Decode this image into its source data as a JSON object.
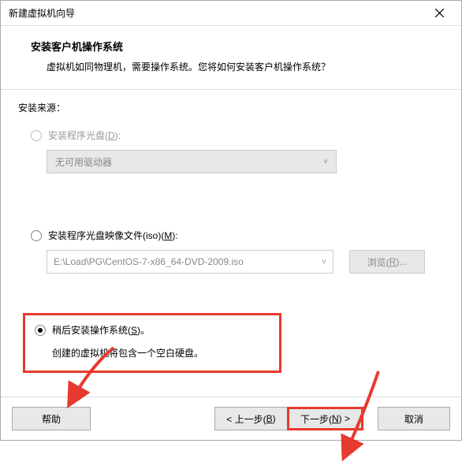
{
  "titlebar": {
    "title": "新建虚拟机向导"
  },
  "header": {
    "title": "安装客户机操作系统",
    "subtitle": "虚拟机如同物理机，需要操作系统。您将如何安装客户机操作系统？"
  },
  "content": {
    "source_label": "安装来源：",
    "opt_disc": {
      "label_prefix": "安装程序光盘(",
      "mnemonic": "D",
      "label_suffix": "):",
      "dropdown": "无可用驱动器"
    },
    "opt_iso": {
      "label_prefix": "安装程序光盘映像文件(iso)(",
      "mnemonic": "M",
      "label_suffix": "):",
      "path": "E:\\Load\\PG\\CentOS-7-x86_64-DVD-2009.iso",
      "browse_prefix": "浏览(",
      "browse_mnem": "R",
      "browse_suffix": ")..."
    },
    "opt_later": {
      "label_prefix": "稍后安装操作系统(",
      "mnemonic": "S",
      "label_suffix": ")。",
      "desc": "创建的虚拟机将包含一个空白硬盘。"
    }
  },
  "footer": {
    "help": "帮助",
    "back_prefix": "< 上一步(",
    "back_mnem": "B",
    "back_suffix": ")",
    "next_prefix": "下一步(",
    "next_mnem": "N",
    "next_suffix": ") >",
    "cancel": "取消"
  }
}
